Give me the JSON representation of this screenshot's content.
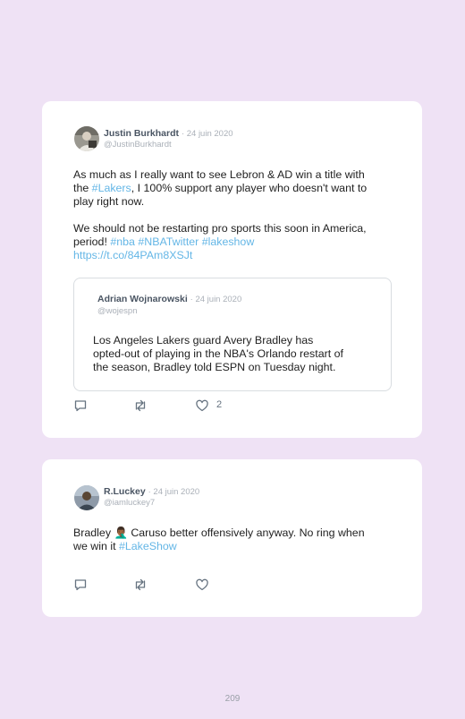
{
  "tweets": [
    {
      "author": "Justin Burkhardt",
      "date": "· 24 juin 2020",
      "handle": "@JustinBurkhardt",
      "line1": "As much as I really want to see Lebron & AD win a title with",
      "line2_a": "the ",
      "line2_link": "#Lakers",
      "line2_b": ", I 100% support any player who doesn't want to",
      "line3": "play right now.",
      "line4": "We should not be restarting pro sports this soon in America,",
      "line5_a": "period! ",
      "line5_tags": "#nba #NBATwitter #lakeshow",
      "url": "https://t.co/84PAm8XSJt",
      "likes": "2",
      "quote": {
        "author": "Adrian Wojnarowski",
        "date": "· 24 juin 2020",
        "handle": "@wojespn",
        "line1": "Los Angeles Lakers guard Avery Bradley has",
        "line2": "opted-out of playing in the NBA's Orlando restart of",
        "line3": "the season, Bradley told ESPN on Tuesday night."
      }
    },
    {
      "author": "R.Luckey",
      "date": "· 24 juin 2020",
      "handle": "@iamluckey7",
      "line1": "Bradley 🤦🏾‍♂️ Caruso better offensively anyway. No ring when",
      "line2_a": "we win it ",
      "line2_link": "#LakeShow"
    }
  ],
  "icons": {
    "reply": "reply-icon",
    "retweet": "retweet-icon",
    "like": "heart-icon"
  },
  "page_number": "209",
  "colors": {
    "background": "#efe2f5",
    "card": "#ffffff",
    "link": "#64b6e6",
    "name": "#4a5563",
    "meta": "#aab0b8"
  }
}
